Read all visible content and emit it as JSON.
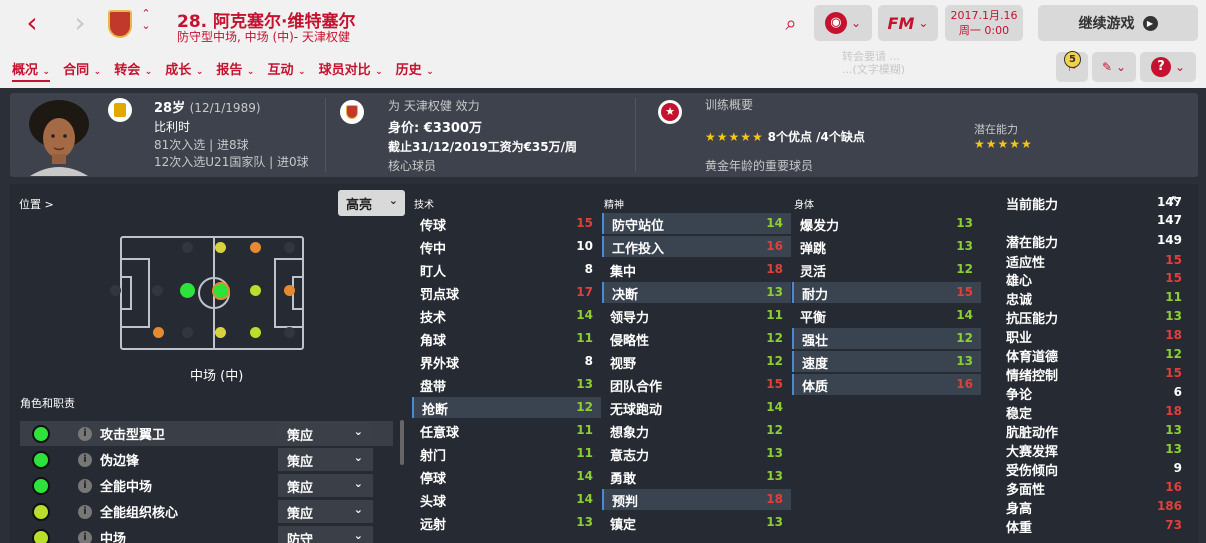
{
  "header": {
    "player_title": "28. 阿克塞尔·维特塞尔",
    "player_subtitle": "防守型中场, 中场 (中)- 天津权健",
    "date_line1": "2017.1月.16",
    "date_line2": "周一 0:00",
    "continue_label": "继续游戏",
    "fm_label": "FM",
    "notifications_count": "5",
    "ghost_text1": "转会要请 ...",
    "ghost_text2": "...(文字模糊)"
  },
  "nav": {
    "tabs": [
      {
        "label": "概况",
        "active": true
      },
      {
        "label": "合同"
      },
      {
        "label": "转会"
      },
      {
        "label": "成长"
      },
      {
        "label": "报告"
      },
      {
        "label": "互动"
      },
      {
        "label": "球员对比"
      },
      {
        "label": "历史"
      }
    ]
  },
  "info": {
    "age": "28岁",
    "dob": "(12/1/1989)",
    "nationality": "比利时",
    "caps": "81次入选 | 进8球",
    "u21_caps": "12次入选U21国家队 | 进0球",
    "club_line": "为 天津权健 效力",
    "value": "身价: €3300万",
    "contract": "截止31/12/2019工资为€35万/周",
    "squad_status": "核心球员",
    "training_title": "训练概要",
    "training_stars": "★★★★★",
    "training_summary": "8个优点 /4个缺点",
    "training_note": "黄金年龄的重要球员",
    "potential_label": "潜在能力",
    "potential_stars": "★★★★★"
  },
  "position": {
    "title": "位置 >",
    "highlight": "高亮",
    "current": "中场 (中)"
  },
  "roles": {
    "title": "角色和职责",
    "items": [
      {
        "name": "攻击型翼卫",
        "duty": "策应",
        "color": "#2ee23c"
      },
      {
        "name": "伪边锋",
        "duty": "策应",
        "color": "#2ee23c"
      },
      {
        "name": "全能中场",
        "duty": "策应",
        "color": "#2ee23c"
      },
      {
        "name": "全能组织核心",
        "duty": "策应",
        "color": "#b8e02a"
      },
      {
        "name": "中场",
        "duty": "防守",
        "color": "#b8e02a"
      }
    ]
  },
  "columns": {
    "technical": "技术",
    "mental": "精神",
    "physical": "身体"
  },
  "technical": [
    {
      "name": "传球",
      "value": "15",
      "c": "r"
    },
    {
      "name": "传中",
      "value": "10",
      "c": "w"
    },
    {
      "name": "盯人",
      "value": "8",
      "c": "w"
    },
    {
      "name": "罚点球",
      "value": "17",
      "c": "r"
    },
    {
      "name": "技术",
      "value": "14",
      "c": "g"
    },
    {
      "name": "角球",
      "value": "11",
      "c": "g"
    },
    {
      "name": "界外球",
      "value": "8",
      "c": "w"
    },
    {
      "name": "盘带",
      "value": "13",
      "c": "g"
    },
    {
      "name": "抢断",
      "value": "12",
      "c": "g",
      "hl": true
    },
    {
      "name": "任意球",
      "value": "11",
      "c": "g"
    },
    {
      "name": "射门",
      "value": "11",
      "c": "g"
    },
    {
      "name": "停球",
      "value": "14",
      "c": "g"
    },
    {
      "name": "头球",
      "value": "14",
      "c": "g"
    },
    {
      "name": "远射",
      "value": "13",
      "c": "g"
    }
  ],
  "mental": [
    {
      "name": "防守站位",
      "value": "14",
      "c": "g",
      "hl": true
    },
    {
      "name": "工作投入",
      "value": "16",
      "c": "r",
      "hl": true
    },
    {
      "name": "集中",
      "value": "18",
      "c": "r"
    },
    {
      "name": "决断",
      "value": "13",
      "c": "g",
      "hl": true
    },
    {
      "name": "领导力",
      "value": "11",
      "c": "g"
    },
    {
      "name": "侵略性",
      "value": "12",
      "c": "g"
    },
    {
      "name": "视野",
      "value": "12",
      "c": "g"
    },
    {
      "name": "团队合作",
      "value": "15",
      "c": "r"
    },
    {
      "name": "无球跑动",
      "value": "14",
      "c": "g"
    },
    {
      "name": "想象力",
      "value": "12",
      "c": "g"
    },
    {
      "name": "意志力",
      "value": "13",
      "c": "g"
    },
    {
      "name": "勇敢",
      "value": "13",
      "c": "g"
    },
    {
      "name": "预判",
      "value": "18",
      "c": "r",
      "hl": true
    },
    {
      "name": "镇定",
      "value": "13",
      "c": "g"
    }
  ],
  "physical": [
    {
      "name": "爆发力",
      "value": "13",
      "c": "g"
    },
    {
      "name": "弹跳",
      "value": "13",
      "c": "g"
    },
    {
      "name": "灵活",
      "value": "12",
      "c": "g"
    },
    {
      "name": "耐力",
      "value": "15",
      "c": "r",
      "hl": true
    },
    {
      "name": "平衡",
      "value": "14",
      "c": "g"
    },
    {
      "name": "强壮",
      "value": "12",
      "c": "g",
      "hl": true
    },
    {
      "name": "速度",
      "value": "13",
      "c": "g",
      "hl": true
    },
    {
      "name": "体质",
      "value": "16",
      "c": "r",
      "hl": true
    }
  ],
  "personal": [
    {
      "name": "当前能力",
      "value": "147",
      "c": "w"
    },
    {
      "name": "",
      "value": "147",
      "c": "w"
    },
    {
      "name": "潜在能力",
      "value": "149",
      "c": "w"
    },
    {
      "name": "适应性",
      "value": "15",
      "c": "r"
    },
    {
      "name": "雄心",
      "value": "15",
      "c": "r"
    },
    {
      "name": "忠诚",
      "value": "11",
      "c": "g"
    },
    {
      "name": "抗压能力",
      "value": "13",
      "c": "g"
    },
    {
      "name": "职业",
      "value": "18",
      "c": "r"
    },
    {
      "name": "体育道德",
      "value": "12",
      "c": "g"
    },
    {
      "name": "情绪控制",
      "value": "15",
      "c": "r"
    },
    {
      "name": "争论",
      "value": "6",
      "c": "w"
    },
    {
      "name": "稳定",
      "value": "18",
      "c": "r"
    },
    {
      "name": "肮脏动作",
      "value": "13",
      "c": "g"
    },
    {
      "name": "大赛发挥",
      "value": "13",
      "c": "g"
    },
    {
      "name": "受伤倾向",
      "value": "9",
      "c": "w"
    },
    {
      "name": "多面性",
      "value": "16",
      "c": "r"
    },
    {
      "name": "身高",
      "value": "186",
      "c": "r"
    },
    {
      "name": "体重",
      "value": "73",
      "c": "r"
    }
  ]
}
